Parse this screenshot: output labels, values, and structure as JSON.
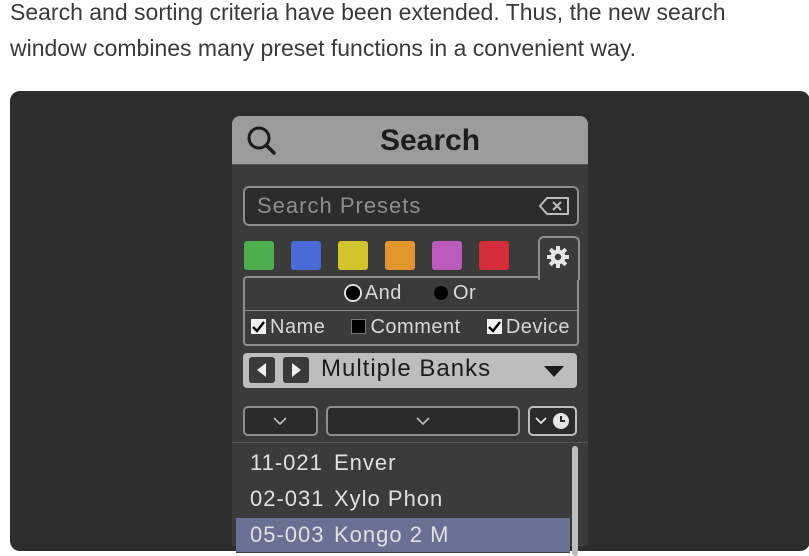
{
  "intro": {
    "line1": "Search and sorting criteria have been extended. Thus, the new search",
    "line2": "window combines many preset functions in a convenient way."
  },
  "panel": {
    "title": "Search",
    "search_placeholder": "Search Presets",
    "color_swatches": [
      {
        "name": "green",
        "color": "#4cae4c"
      },
      {
        "name": "blue",
        "color": "#4a6ad8"
      },
      {
        "name": "yellow",
        "color": "#d4c42c"
      },
      {
        "name": "orange",
        "color": "#e3962c"
      },
      {
        "name": "purple",
        "color": "#bb5cbc"
      },
      {
        "name": "red",
        "color": "#d42c38"
      }
    ],
    "logic": {
      "and_label": "And",
      "or_label": "Or",
      "selected": "And"
    },
    "fields": {
      "name_label": "Name",
      "name_checked": true,
      "comment_label": "Comment",
      "comment_checked": false,
      "device_label": "Device",
      "device_checked": true
    },
    "bank_selector": {
      "value": "Multiple Banks"
    },
    "presets": [
      {
        "code": "11-021",
        "name": "Enver",
        "selected": false
      },
      {
        "code": "02-031",
        "name": "Xylo Phon",
        "selected": false
      },
      {
        "code": "05-003",
        "name": "Kongo 2 M",
        "selected": true
      }
    ]
  },
  "colors": {
    "page_bg": "#ffffff",
    "stage_bg": "#2e2d2d",
    "panel_bg": "#3b3b3b",
    "header_bg": "#9c9c9c",
    "selected_row": "#6a6f94"
  }
}
